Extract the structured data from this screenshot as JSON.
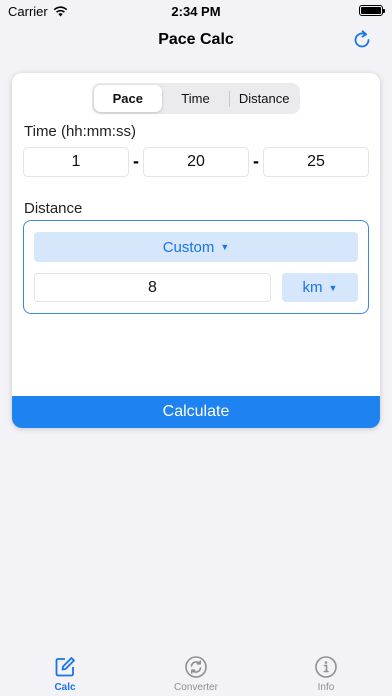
{
  "status": {
    "carrier": "Carrier",
    "time": "2:34 PM"
  },
  "nav": {
    "title": "Pace Calc",
    "refresh_icon": "refresh-icon"
  },
  "segments": {
    "items": [
      "Pace",
      "Time",
      "Distance"
    ],
    "selected": "Pace"
  },
  "time": {
    "label": "Time (hh:mm:ss)",
    "hours": "1",
    "minutes": "20",
    "seconds": "25",
    "separator": "-"
  },
  "distance": {
    "label": "Distance",
    "preset": "Custom",
    "value": "8",
    "unit": "km"
  },
  "calculate_label": "Calculate",
  "tabs": [
    {
      "label": "Calc",
      "icon": "edit-icon",
      "active": true
    },
    {
      "label": "Converter",
      "icon": "convert-icon",
      "active": false
    },
    {
      "label": "Info",
      "icon": "info-icon",
      "active": false
    }
  ],
  "colors": {
    "accent": "#1a74e8",
    "button": "#1e82f0",
    "light_accent": "#d6e7fc",
    "inactive": "#8e8e93"
  }
}
